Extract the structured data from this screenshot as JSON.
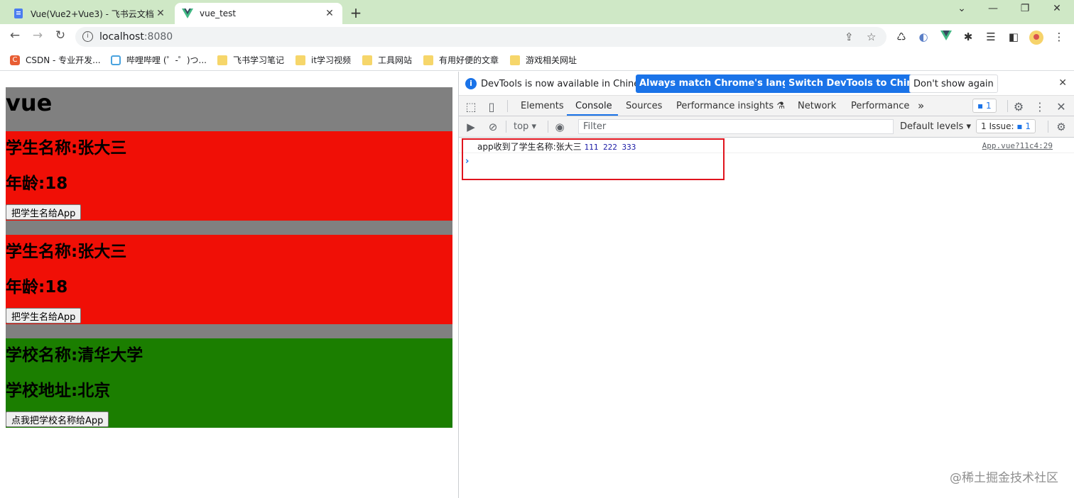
{
  "tabs": [
    {
      "title": "Vue(Vue2+Vue3) - 飞书云文档",
      "icon": "doc-icon",
      "active": false
    },
    {
      "title": "vue_test",
      "icon": "vue-logo-icon",
      "active": true
    }
  ],
  "address": {
    "host": "localhost",
    "port": ":8080"
  },
  "bookmarks": [
    {
      "label": "CSDN - 专业开发...",
      "icon": "csdn-icon"
    },
    {
      "label": "哔哩哔哩 (゜-゜)つ...",
      "icon": "bilibili-icon"
    },
    {
      "label": "飞书学习笔记",
      "icon": "folder-icon"
    },
    {
      "label": "it学习视频",
      "icon": "folder-icon"
    },
    {
      "label": "工具网站",
      "icon": "folder-icon"
    },
    {
      "label": "有用好便的文章",
      "icon": "folder-icon"
    },
    {
      "label": "游戏相关网址",
      "icon": "folder-icon"
    }
  ],
  "app": {
    "heading": "vue",
    "student1": {
      "name": "学生名称:张大三",
      "age": "年龄:18",
      "button": "把学生名给App"
    },
    "student2": {
      "name": "学生名称:张大三",
      "age": "年龄:18",
      "button": "把学生名给App"
    },
    "school": {
      "name": "学校名称:清华大学",
      "address": "学校地址:北京",
      "button": "点我把学校名称给App"
    },
    "colors": {
      "app_bg": "#808080",
      "student_bg": "#f00f06",
      "school_bg": "#1b7e00"
    }
  },
  "devtools": {
    "infobar": {
      "message": "DevTools is now available in Chinese!",
      "btn_match": "Always match Chrome's language",
      "btn_switch": "Switch DevTools to Chinese",
      "btn_dismiss": "Don't show again"
    },
    "tabs": [
      "Elements",
      "Console",
      "Sources",
      "Performance insights",
      "Network",
      "Performance"
    ],
    "active_tab": "Console",
    "more": "»",
    "issues_badge": "1",
    "console_toolbar": {
      "context": "top",
      "filter_placeholder": "Filter",
      "levels": "Default levels",
      "issues_label": "1 Issue:",
      "issues_count": "1"
    },
    "log": {
      "message": "app收到了学生名称:张大三",
      "args": "111 222 333",
      "source": "App.vue?11c4:29"
    },
    "prompt": "›"
  },
  "watermark": "@稀土掘金技术社区"
}
